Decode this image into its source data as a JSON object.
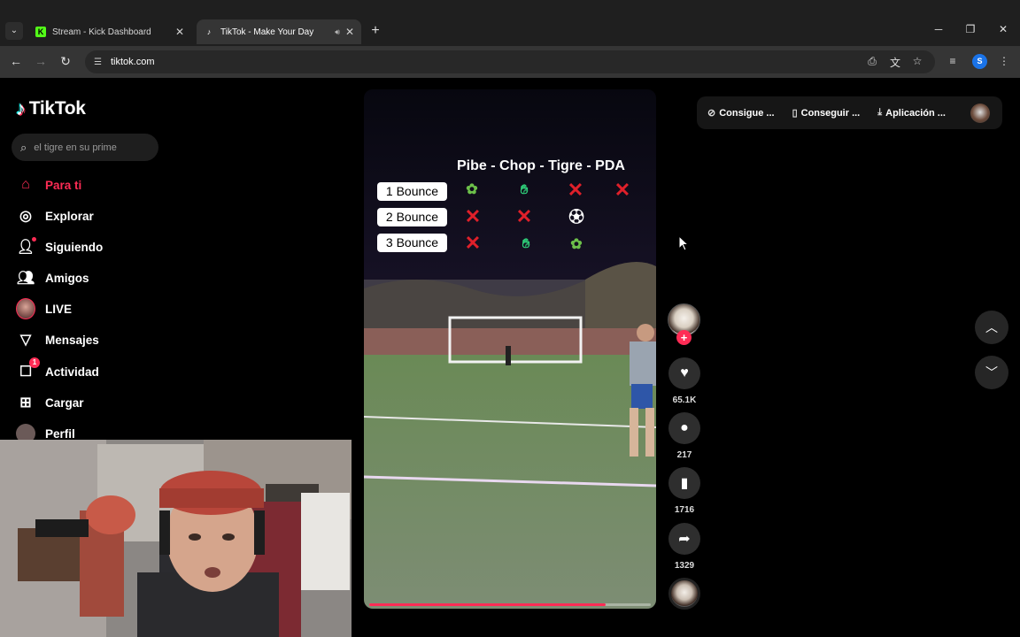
{
  "browser": {
    "tabs": [
      {
        "title": "Stream - Kick Dashboard",
        "favicon": "kick-icon"
      },
      {
        "title": "TikTok - Make Your Day",
        "favicon": "tiktok-icon",
        "audio": true
      }
    ],
    "url": "tiktok.com",
    "profile_initial": "S"
  },
  "tiktok": {
    "logo_text": "TikTok",
    "search_placeholder": "el tigre en su prime",
    "menu": [
      {
        "label": "Para ti",
        "icon": "home-icon",
        "active": true
      },
      {
        "label": "Explorar",
        "icon": "compass-icon"
      },
      {
        "label": "Siguiendo",
        "icon": "following-icon"
      },
      {
        "label": "Amigos",
        "icon": "friends-icon"
      },
      {
        "label": "LIVE",
        "icon": "live-avatar"
      },
      {
        "label": "Mensajes",
        "icon": "send-icon"
      },
      {
        "label": "Actividad",
        "icon": "activity-icon",
        "badge": "1"
      },
      {
        "label": "Cargar",
        "icon": "upload-icon"
      },
      {
        "label": "Perfil",
        "icon": "profile-avatar"
      }
    ],
    "top_actions": [
      {
        "label": "Consigue ...",
        "icon": "coin-icon"
      },
      {
        "label": "Conseguir ...",
        "icon": "phone-icon"
      },
      {
        "label": "Aplicación ...",
        "icon": "download-icon"
      }
    ],
    "video": {
      "overlay_title": "Pibe - Chop - Tigre - PDA",
      "rows": [
        {
          "label": "1 Bounce",
          "marks": [
            "tree",
            "glove",
            "x",
            "x"
          ]
        },
        {
          "label": "2 Bounce",
          "marks": [
            "x",
            "x",
            "ball"
          ]
        },
        {
          "label": "3 Bounce",
          "marks": [
            "x",
            "glove",
            "tree"
          ]
        }
      ],
      "progress": 0.84
    },
    "actions": {
      "likes": "65.1K",
      "comments": "217",
      "saves": "1716",
      "shares": "1329"
    }
  }
}
